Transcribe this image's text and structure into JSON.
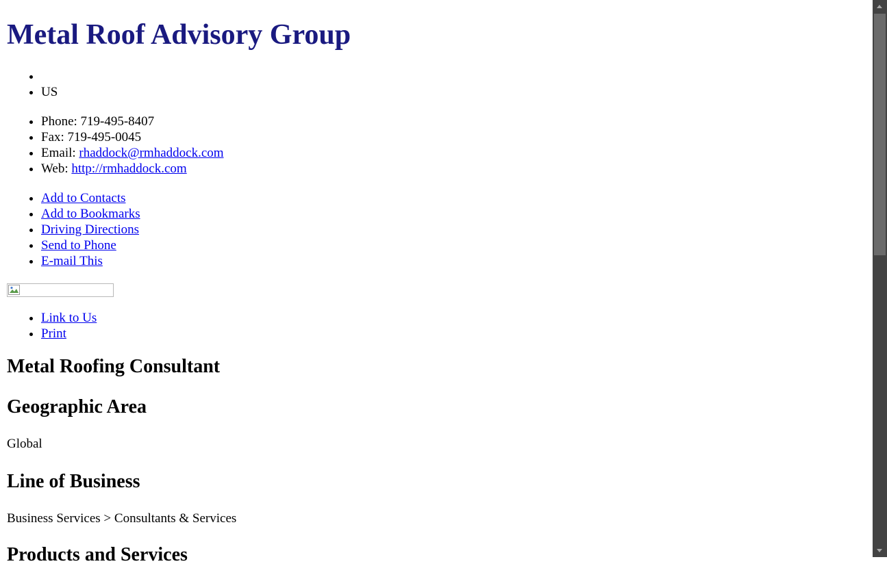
{
  "business": {
    "name": "Metal Roof Advisory Group",
    "address_lines": [
      "",
      "US"
    ]
  },
  "contact": {
    "phone_label": "Phone:",
    "phone": "719-495-8407",
    "fax_label": "Fax:",
    "fax": "719-495-0045",
    "email_label": "Email:",
    "email": "rhaddock@rmhaddock.com",
    "web_label": "Web:",
    "web": "http://rmhaddock.com"
  },
  "actions": [
    "Add to Contacts",
    "Add to Bookmarks",
    "Driving Directions",
    "Send to Phone",
    "E-mail This"
  ],
  "share": [
    "Link to Us",
    "Print"
  ],
  "sections": {
    "category_heading": "Metal Roofing Consultant",
    "geo_heading": "Geographic Area",
    "geo_value": "Global",
    "lob_heading": "Line of Business",
    "lob_value": "Business Services > Consultants & Services",
    "products_heading": "Products and Services"
  },
  "colors": {
    "title": "#1a1a80",
    "link": "#0000ee",
    "scrollbar_track": "#434343",
    "scrollbar_thumb": "#6b6b6b"
  },
  "icons": {
    "image_placeholder": "broken-image-icon",
    "scroll_up": "arrow-up-icon",
    "scroll_down": "arrow-down-icon"
  }
}
